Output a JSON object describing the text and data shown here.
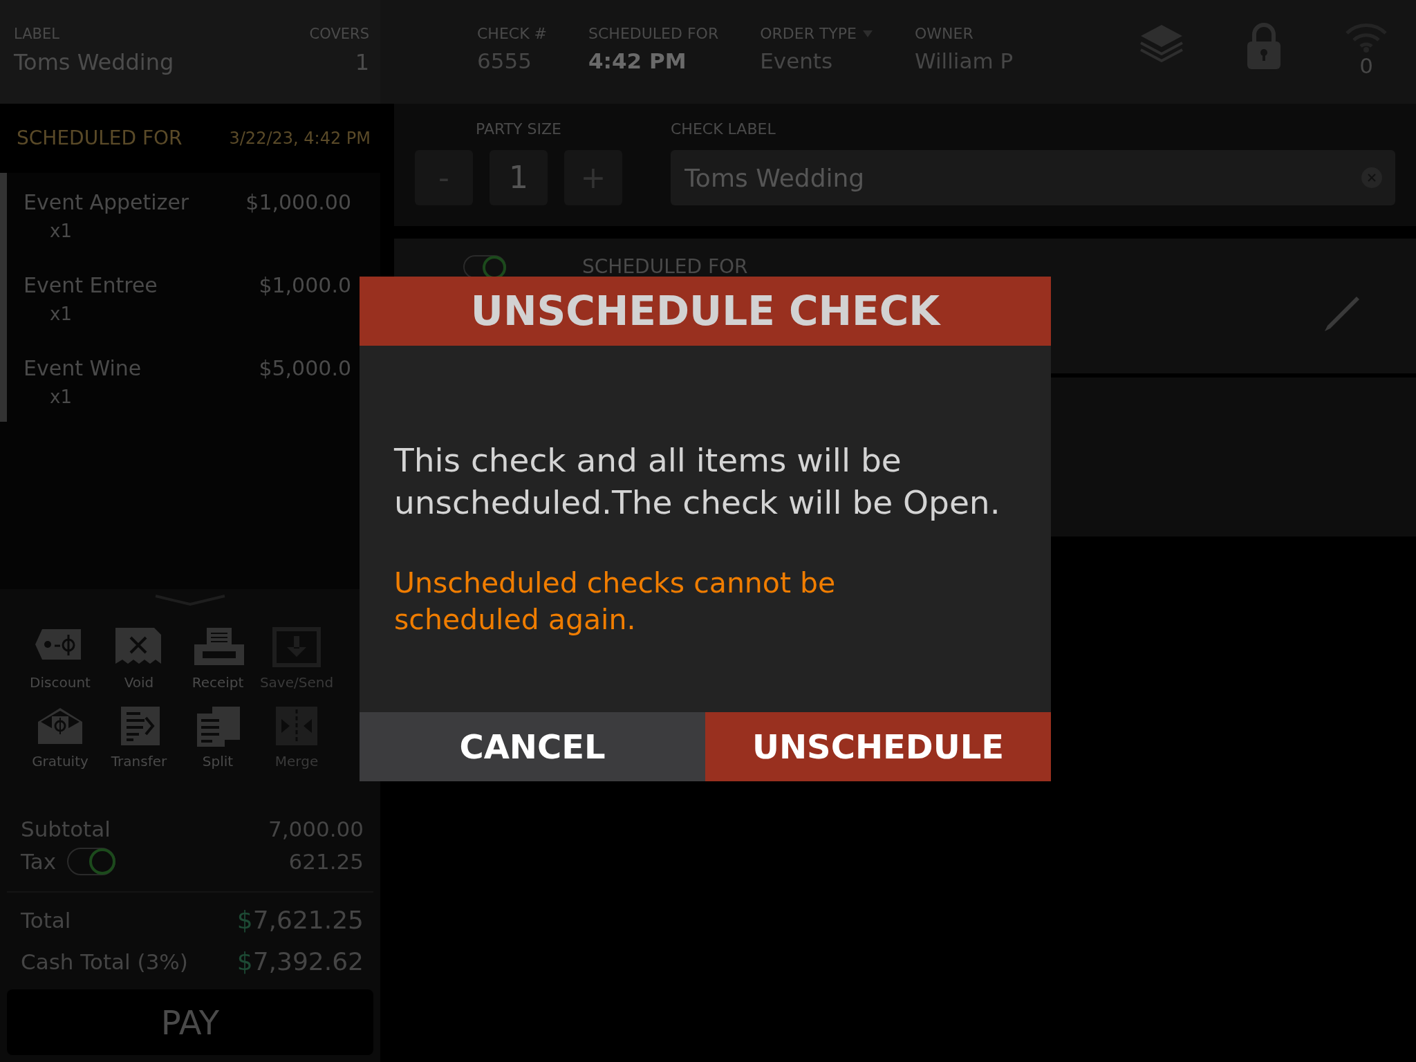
{
  "check_header": {
    "label_caption": "LABEL",
    "label": "Toms Wedding",
    "covers_caption": "COVERS",
    "covers": "1"
  },
  "scheduled_banner": {
    "caption": "SCHEDULED FOR",
    "datetime": "3/22/23, 4:42 PM"
  },
  "items": [
    {
      "name": "Event Appetizer",
      "qty": "x1",
      "price": "$1,000.00"
    },
    {
      "name": "Event Entree",
      "qty": "x1",
      "price": "$1,000.0"
    },
    {
      "name": "Event Wine",
      "qty": "x1",
      "price": "$5,000.0"
    }
  ],
  "actions": [
    {
      "kind": "discount",
      "label": "Discount",
      "disabled": false
    },
    {
      "kind": "void",
      "label": "Void",
      "disabled": false
    },
    {
      "kind": "receipt",
      "label": "Receipt",
      "disabled": false
    },
    {
      "kind": "save",
      "label": "Save/Send",
      "disabled": true
    },
    {
      "kind": "gratuity",
      "label": "Gratuity",
      "disabled": false
    },
    {
      "kind": "transfer",
      "label": "Transfer",
      "disabled": false
    },
    {
      "kind": "split",
      "label": "Split",
      "disabled": false
    },
    {
      "kind": "merge",
      "label": "Merge",
      "disabled": true
    }
  ],
  "subtotals": [
    {
      "label": "Subtotal",
      "value": "7,000.00"
    },
    {
      "label": "Tax",
      "value": "621.25",
      "toggle_on": true
    }
  ],
  "totals": [
    {
      "label": "Total",
      "currency": "$",
      "amount": "7,621.25"
    },
    {
      "label": "Cash Total (3%)",
      "currency": "$",
      "amount": "7,392.62"
    }
  ],
  "pay_button": "PAY",
  "top_bar": {
    "fields": [
      {
        "kind": "plain",
        "caption": "CHECK #",
        "value": "6555"
      },
      {
        "kind": "emphasis",
        "caption": "SCHEDULED FOR",
        "value": "4:42 PM"
      },
      {
        "kind": "dropdown",
        "caption": "ORDER TYPE",
        "value": "Events"
      },
      {
        "kind": "plain",
        "caption": "OWNER",
        "value": "William P"
      }
    ],
    "wifi_count": "0"
  },
  "party_size": {
    "caption": "PARTY SIZE",
    "minus": "-",
    "value": "1",
    "plus": "+"
  },
  "check_label": {
    "caption": "CHECK LABEL",
    "value": "Toms Wedding"
  },
  "scheduled_card": {
    "on": true,
    "caption": "SCHEDULED FOR"
  },
  "dialog": {
    "title": "UNSCHEDULE CHECK",
    "message": "This check and all items will be unscheduled.The check will be Open.",
    "warning": "Unscheduled checks cannot be scheduled again.",
    "buttons": [
      {
        "kind": "secondary",
        "label": "CANCEL"
      },
      {
        "kind": "primary",
        "label": "UNSCHEDULE"
      }
    ]
  }
}
